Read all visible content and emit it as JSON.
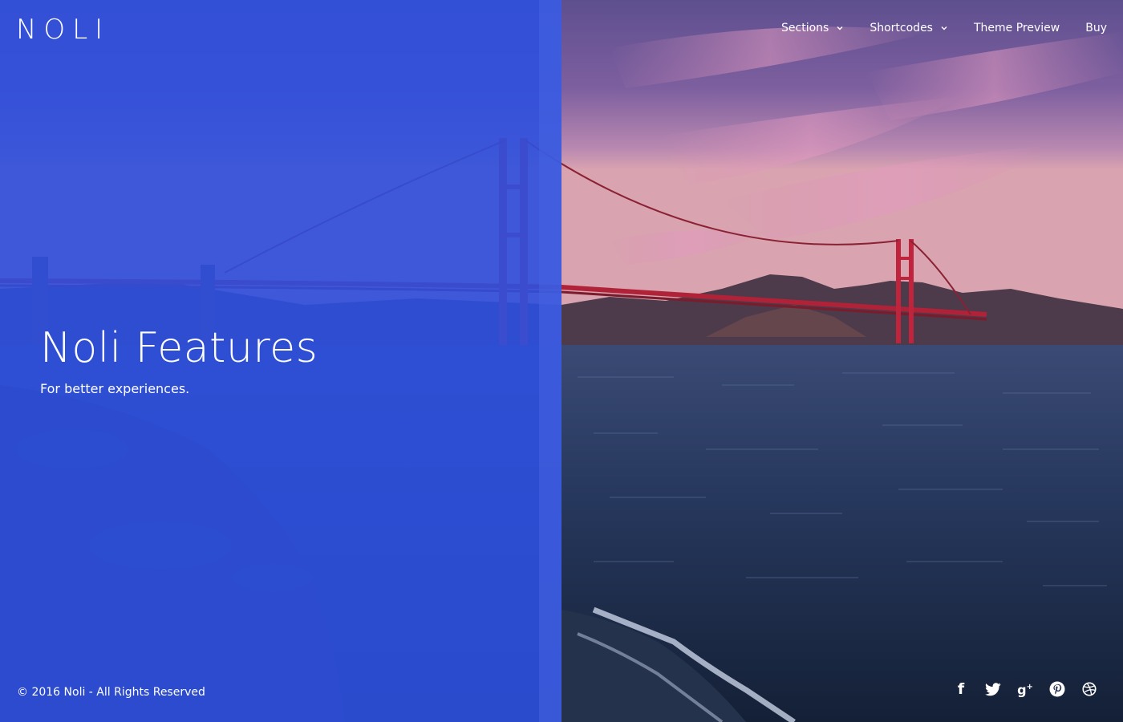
{
  "header": {
    "logo": "NOLI",
    "nav": [
      {
        "label": "Sections",
        "dropdown": true
      },
      {
        "label": "Shortcodes",
        "dropdown": true
      },
      {
        "label": "Theme Preview",
        "dropdown": false
      },
      {
        "label": "Buy",
        "dropdown": false
      }
    ]
  },
  "hero": {
    "title": "Noli Features",
    "subtitle": "For better experiences."
  },
  "footer": {
    "copyright": "© 2016 Noli - All Rights Reserved",
    "social": [
      {
        "icon": "facebook-icon"
      },
      {
        "icon": "twitter-icon"
      },
      {
        "icon": "google-plus-icon"
      },
      {
        "icon": "pinterest-icon"
      },
      {
        "icon": "dribbble-icon"
      }
    ]
  },
  "colors": {
    "overlay": "#2e50de",
    "text": "#ffffff",
    "sky_top": "#6a5c9a",
    "sky_bottom": "#c98aa8",
    "water": "#1f3152",
    "bridge": "#c0243c"
  }
}
